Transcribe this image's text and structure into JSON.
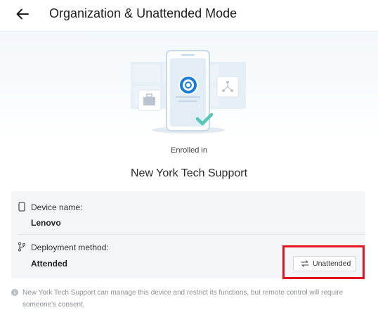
{
  "header": {
    "title": "Organization & Unattended Mode"
  },
  "enrollment": {
    "label": "Enrolled in",
    "organization": "New York Tech Support"
  },
  "device": {
    "name_label": "Device name:",
    "name_value": "Lenovo",
    "deployment_label": "Deployment method:",
    "deployment_value": "Attended",
    "action_button_label": "Unattended"
  },
  "note": {
    "text": "New York Tech Support can manage this device and restrict its functions, but remote control will require someone's consent."
  },
  "colors": {
    "accent": "#1a7ed6",
    "check": "#56c7b5",
    "highlight": "#e5141f"
  }
}
